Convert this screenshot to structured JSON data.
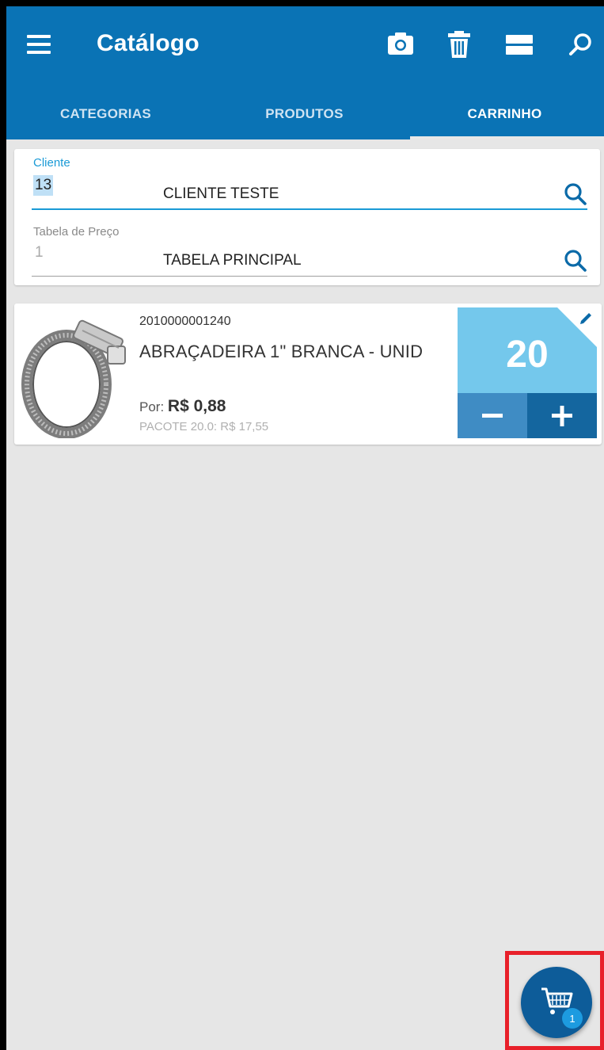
{
  "header": {
    "title": "Catálogo",
    "actions": [
      "camera-icon",
      "trash-icon",
      "view-toggle-icon",
      "search-icon"
    ]
  },
  "tabs": [
    {
      "label": "CATEGORIAS",
      "active": false
    },
    {
      "label": "PRODUTOS",
      "active": false
    },
    {
      "label": "CARRINHO",
      "active": true
    }
  ],
  "client_form": {
    "client_label": "Cliente",
    "client_code": "13",
    "client_name": "CLIENTE TESTE",
    "price_table_label": "Tabela de Preço",
    "price_table_code": "1",
    "price_table_name": "TABELA PRINCIPAL"
  },
  "cart_item": {
    "code": "2010000001240",
    "name": "ABRAÇADEIRA 1\" BRANCA - UNID",
    "price_prefix": "Por:",
    "price": "R$ 0,88",
    "package": "PACOTE 20.0: R$ 17,55",
    "quantity": "20"
  },
  "fab": {
    "icon": "cart-icon",
    "badge": "1"
  },
  "colors": {
    "primary": "#0a73b5",
    "accent": "#1a9ad6",
    "qty_bg": "#74c8ec",
    "fab": "#0d5c99",
    "highlight": "#e8202a"
  }
}
